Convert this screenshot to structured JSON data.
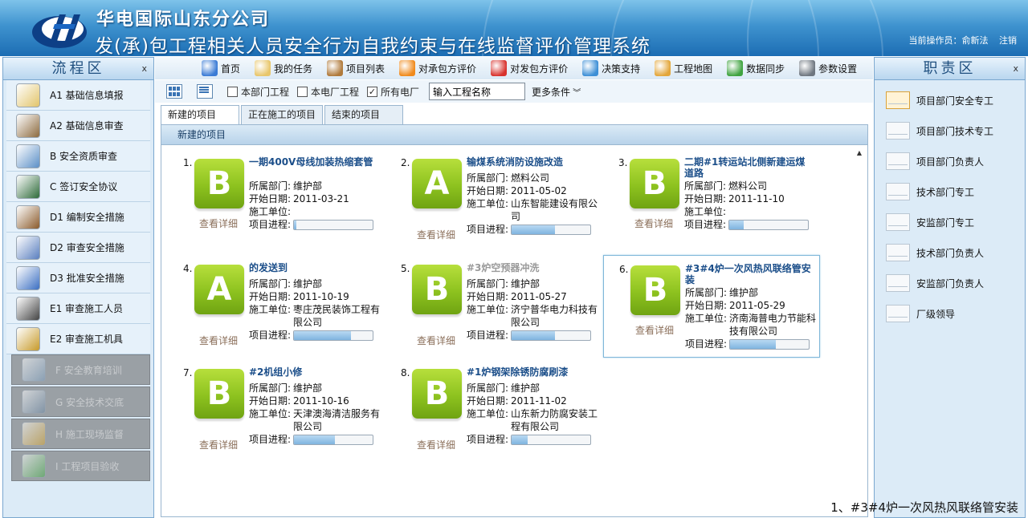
{
  "header": {
    "company": "华电国际山东分公司",
    "system_title": "发(承)包工程相关人员安全行为自我约束与在线监督评价管理系统",
    "operator_label": "当前操作员：",
    "operator_name": "俞新法",
    "logout": "注销"
  },
  "left_panel": {
    "title": "流程区",
    "close": "x",
    "items": [
      {
        "label": "A1  基础信息填报",
        "icon": "notebook-icon",
        "enabled": true
      },
      {
        "label": "A2  基础信息审查",
        "icon": "building-icon",
        "enabled": true
      },
      {
        "label": "B   安全资质审查",
        "icon": "magnifier-icon",
        "enabled": true
      },
      {
        "label": "C  签订安全协议",
        "icon": "blackboard-icon",
        "enabled": true
      },
      {
        "label": "D1  编制安全措施",
        "icon": "contact-book-icon",
        "enabled": true
      },
      {
        "label": "D2  审查安全措施",
        "icon": "shield-icon",
        "enabled": true
      },
      {
        "label": "D3  批准安全措施",
        "icon": "pipe-icon",
        "enabled": true
      },
      {
        "label": "E1  审查施工人员",
        "icon": "person-icon",
        "enabled": true
      },
      {
        "label": "E2  审查施工机具",
        "icon": "padlock-icon",
        "enabled": true
      },
      {
        "label": "F  安全教育培训",
        "icon": "pencil-ruler-icon",
        "enabled": false
      },
      {
        "label": "G  安全技术交底",
        "icon": "anchor-icon",
        "enabled": false
      },
      {
        "label": "H  施工现场监督",
        "icon": "pedestrian-sign-icon",
        "enabled": false
      },
      {
        "label": "I  工程项目验收",
        "icon": "check-icon",
        "enabled": false
      }
    ]
  },
  "right_panel": {
    "title": "职责区",
    "close": "x",
    "items": [
      {
        "label": "项目部门安全专工",
        "icon": "mail-unread-icon"
      },
      {
        "label": "项目部门技术专工",
        "icon": "mail-icon"
      },
      {
        "label": "项目部门负责人",
        "icon": "mail-icon"
      },
      {
        "label": "技术部门专工",
        "icon": "mail-icon"
      },
      {
        "label": "安监部门专工",
        "icon": "mail-icon"
      },
      {
        "label": "技术部门负责人",
        "icon": "mail-icon"
      },
      {
        "label": "安监部门负责人",
        "icon": "mail-icon"
      },
      {
        "label": "厂级领导",
        "icon": "mail-icon"
      }
    ]
  },
  "toolbar": [
    {
      "label": "首页",
      "icon": "home-icon",
      "color": "#3a7bd5"
    },
    {
      "label": "我的任务",
      "icon": "envelope-icon",
      "color": "#e8c66a"
    },
    {
      "label": "项目列表",
      "icon": "clipboard-icon",
      "color": "#b07a3b"
    },
    {
      "label": "对承包方评价",
      "icon": "chat-orange-icon",
      "color": "#f08a1c"
    },
    {
      "label": "对发包方评价",
      "icon": "chat-red-icon",
      "color": "#d8322d"
    },
    {
      "label": "决策支持",
      "icon": "pie-chart-icon",
      "color": "#3d8fd6"
    },
    {
      "label": "工程地图",
      "icon": "map-icon",
      "color": "#e3a63a"
    },
    {
      "label": "数据同步",
      "icon": "sync-icon",
      "color": "#3fa33f"
    },
    {
      "label": "参数设置",
      "icon": "gear-icon",
      "color": "#6f7780"
    }
  ],
  "filters": {
    "dept_project": {
      "label": "本部门工程",
      "checked": false
    },
    "plant_project": {
      "label": "本电厂工程",
      "checked": false
    },
    "all_plants": {
      "label": "所有电厂",
      "checked": true
    },
    "search_value": "输入工程名称",
    "more": "更多条件"
  },
  "tabs": [
    {
      "label": "新建的项目",
      "active": true
    },
    {
      "label": "正在施工的项目",
      "active": false
    },
    {
      "label": "结束的项目",
      "active": false
    }
  ],
  "section_title": "新建的项目",
  "labels": {
    "dept": "所属部门:",
    "start": "开始日期:",
    "unit": "施工单位:",
    "progress": "项目进程:",
    "detail": "查看详细"
  },
  "projects": [
    {
      "num": "1.",
      "grade": "B",
      "title": "一期400V母线加装热缩套管",
      "dept": "维护部",
      "start": "2011-03-21",
      "unit": "",
      "progress": 0.03,
      "gray": false
    },
    {
      "num": "2.",
      "grade": "A",
      "title": "输煤系统消防设施改造",
      "dept": "燃料公司",
      "start": "2011-05-02",
      "unit": "山东智能建设有限公司",
      "progress": 0.55,
      "gray": false
    },
    {
      "num": "3.",
      "grade": "B",
      "title": "二期#1转运站北侧新建运煤道路",
      "dept": "燃料公司",
      "start": "2011-11-10",
      "unit": "",
      "progress": 0.18,
      "gray": false
    },
    {
      "num": "4.",
      "grade": "A",
      "title": "的发送到",
      "dept": "维护部",
      "start": "2011-10-19",
      "unit": "枣庄茂民装饰工程有限公司",
      "progress": 0.72,
      "gray": false
    },
    {
      "num": "5.",
      "grade": "B",
      "title": "#3炉空预器冲洗",
      "dept": "维护部",
      "start": "2011-05-27",
      "unit": "济宁普华电力科技有限公司",
      "progress": 0.55,
      "gray": true
    },
    {
      "num": "6.",
      "grade": "B",
      "title": "#3#4炉一次风热风联络管安装",
      "dept": "维护部",
      "start": "2011-05-29",
      "unit": "济南海普电力节能科技有限公司",
      "progress": 0.58,
      "gray": false,
      "selected": true
    },
    {
      "num": "7.",
      "grade": "B",
      "title": "#2机组小修",
      "dept": "维护部",
      "start": "2011-10-16",
      "unit": "天津澳海清洁服务有限公司",
      "progress": 0.52,
      "gray": false
    },
    {
      "num": "8.",
      "grade": "B",
      "title": "#1炉钢架除锈防腐刷漆",
      "dept": "维护部",
      "start": "2011-11-02",
      "unit": "山东新力防腐安装工程有限公司",
      "progress": 0.2,
      "gray": false
    }
  ],
  "status_text": "1、#3#4炉一次风热风联络管安装"
}
